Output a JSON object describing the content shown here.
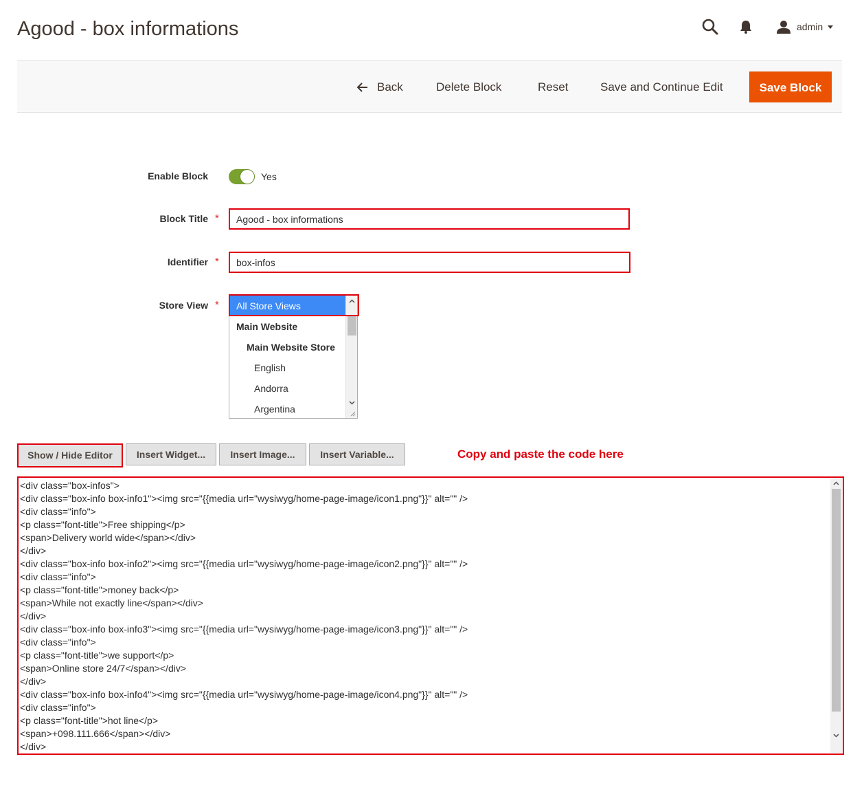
{
  "header": {
    "page_title": "Agood - box informations",
    "user_name": "admin"
  },
  "actions": {
    "back": "Back",
    "delete": "Delete Block",
    "reset": "Reset",
    "save_continue": "Save and Continue Edit",
    "save": "Save Block"
  },
  "form": {
    "enable": {
      "label": "Enable Block",
      "value_text": "Yes",
      "checked": true
    },
    "title": {
      "label": "Block Title",
      "required": "*",
      "value": "Agood - box informations"
    },
    "identifier": {
      "label": "Identifier",
      "required": "*",
      "value": "box-infos"
    },
    "store_view": {
      "label": "Store View",
      "required": "*",
      "options": [
        {
          "label": "All Store Views",
          "selected": true,
          "group": false
        },
        {
          "label": "Main Website",
          "selected": false,
          "group": true
        },
        {
          "label": "Main Website Store",
          "selected": false,
          "group": true
        },
        {
          "label": "English",
          "selected": false,
          "group": false
        },
        {
          "label": "Andorra",
          "selected": false,
          "group": false
        },
        {
          "label": "Argentina",
          "selected": false,
          "group": false
        }
      ]
    }
  },
  "editor": {
    "show_hide": "Show / Hide Editor",
    "insert_widget": "Insert Widget...",
    "insert_image": "Insert Image...",
    "insert_variable": "Insert Variable...",
    "annotation": "Copy and paste the code here",
    "content_lines": [
      "<div class=\"box-infos\">",
      "<div class=\"box-info box-info1\"><img src=\"{{media url=\"wysiwyg/home-page-image/icon1.png\"}}\" alt=\"\" />",
      "<div class=\"info\">",
      "<p class=\"font-title\">Free shipping</p>",
      "<span>Delivery world wide</span></div>",
      "</div>",
      "<div class=\"box-info box-info2\"><img src=\"{{media url=\"wysiwyg/home-page-image/icon2.png\"}}\" alt=\"\" />",
      "<div class=\"info\">",
      "<p class=\"font-title\">money back</p>",
      "<span>While not exactly line</span></div>",
      "</div>",
      "<div class=\"box-info box-info3\"><img src=\"{{media url=\"wysiwyg/home-page-image/icon3.png\"}}\" alt=\"\" />",
      "<div class=\"info\">",
      "<p class=\"font-title\">we support</p>",
      "<span>Online store 24/7</span></div>",
      "</div>",
      "<div class=\"box-info box-info4\"><img src=\"{{media url=\"wysiwyg/home-page-image/icon4.png\"}}\" alt=\"\" />",
      "<div class=\"info\">",
      "<p class=\"font-title\">hot line</p>",
      "<span>+098.111.666</span></div>",
      "</div>"
    ]
  },
  "colors": {
    "accent": "#eb5202",
    "highlight_outline": "#e0000d",
    "toggle_on": "#79a22e",
    "selected_option": "#3d8af7"
  }
}
